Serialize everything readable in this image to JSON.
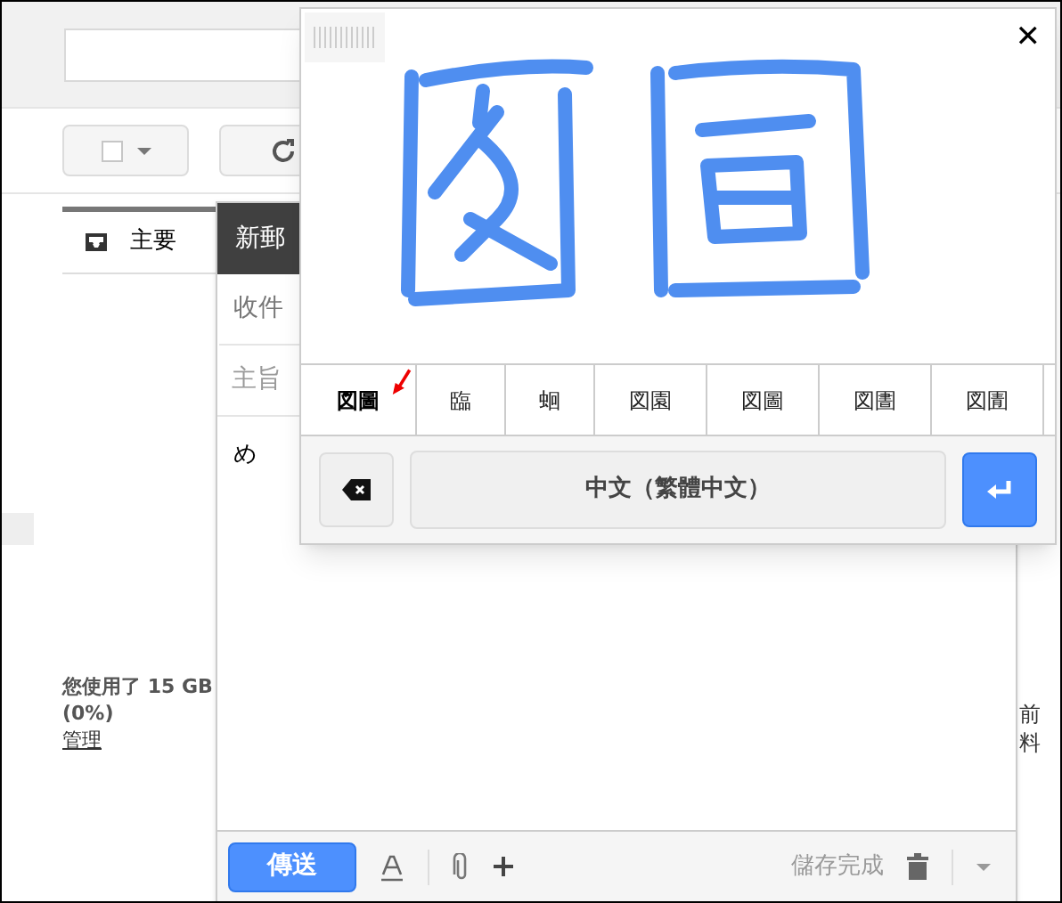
{
  "inbox_tab": {
    "label": "主要",
    "selected": true
  },
  "storage": {
    "usage": "您使用了 15 GB",
    "percent": "(0%)",
    "manage_link": "管理"
  },
  "right_edge_text": [
    "前",
    "料"
  ],
  "compose": {
    "title": "新郵",
    "to_label": "收件",
    "subject_label": "主旨",
    "body": "め",
    "send_button": "傳送",
    "status": "儲存完成"
  },
  "handwriting_panel": {
    "close": "✕",
    "candidates": [
      {
        "text": "図圖",
        "selected": true
      },
      {
        "text": "臨",
        "selected": false
      },
      {
        "text": "蛔",
        "selected": false
      },
      {
        "text": "図園",
        "selected": false
      },
      {
        "text": "図圖",
        "selected": false
      },
      {
        "text": "図圕",
        "selected": false
      },
      {
        "text": "図圊",
        "selected": false
      }
    ],
    "language_button": "中文（繁體中文）"
  }
}
